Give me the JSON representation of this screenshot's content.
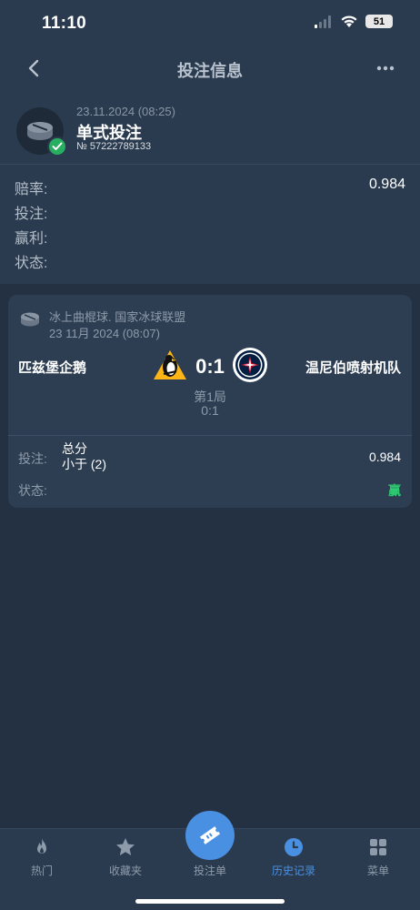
{
  "status_bar": {
    "time": "11:10",
    "battery": "51"
  },
  "header": {
    "title": "投注信息"
  },
  "bet": {
    "date": "23.11.2024 (08:25)",
    "type": "单式投注",
    "number": "№ 57222789133",
    "odds_label": "赔率:",
    "odds_value": "0.984",
    "stake_label": "投注:",
    "profit_label": "赢利:",
    "status_label": "状态:"
  },
  "event": {
    "league": "冰上曲棍球. 国家冰球联盟",
    "date": "23 11月 2024 (08:07)",
    "home_team": "匹兹堡企鹅",
    "away_team": "温尼伯喷射机队",
    "score": "0:1",
    "period": "第1局",
    "period_score": "0:1",
    "bet_label": "投注:",
    "market_line1": "总分",
    "market_line2": "小于 (2)",
    "bet_odds": "0.984",
    "status_label": "状态:",
    "status_value": "赢"
  },
  "nav": {
    "items": [
      {
        "label": "热门",
        "icon": "fire-icon"
      },
      {
        "label": "收藏夹",
        "icon": "star-icon"
      },
      {
        "label": "投注单",
        "icon": "ticket-icon"
      },
      {
        "label": "历史记录",
        "icon": "clock-icon"
      },
      {
        "label": "菜单",
        "icon": "grid-icon"
      }
    ],
    "active_index": 3
  },
  "colors": {
    "background": "#243142",
    "panel": "#2b3b4f",
    "card": "#2d3e52",
    "accent": "#4a90e2",
    "win": "#2ecc71",
    "check": "#27ae60"
  }
}
